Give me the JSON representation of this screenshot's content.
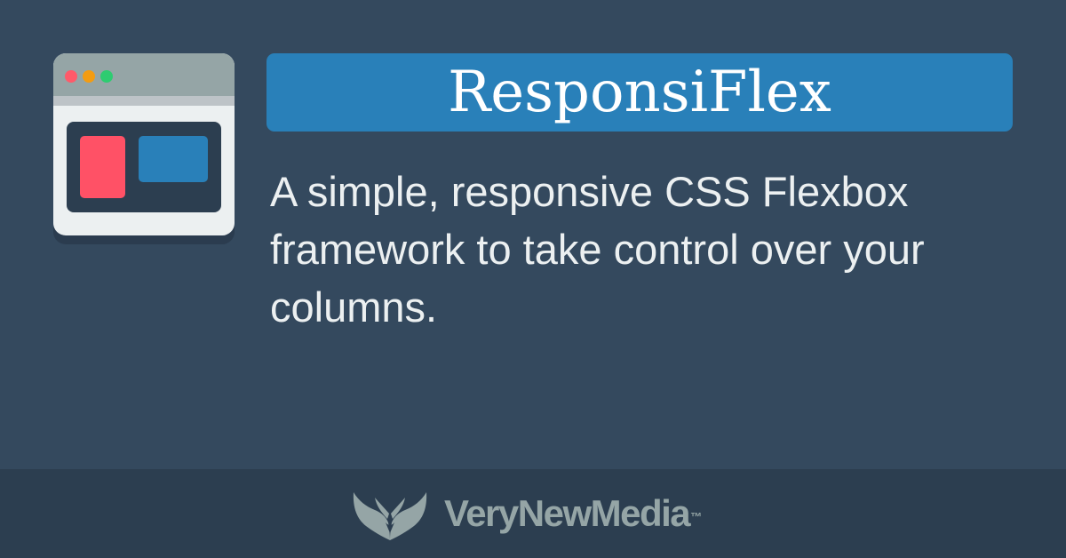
{
  "title": "ResponsiFlex",
  "description": "A simple, responsive CSS Flexbox framework to take control over your columns.",
  "footer": {
    "brand": "VeryNewMedia",
    "trademark": "™",
    "logo_icon": "wings-icon"
  },
  "colors": {
    "background": "#34495e",
    "footer_background": "#2c3e50",
    "accent": "#2980b9",
    "highlight_red": "#ff5166",
    "text": "#ecf0f1",
    "muted": "#95a5a6"
  },
  "illustration": {
    "icon": "browser-window-icon",
    "window_dots": [
      "red",
      "orange",
      "green"
    ]
  }
}
